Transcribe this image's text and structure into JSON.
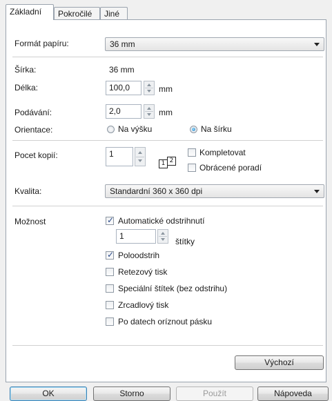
{
  "tabs": [
    {
      "label": "Základní"
    },
    {
      "label": "Pokročilé"
    },
    {
      "label": "Jiné"
    }
  ],
  "paper_format": {
    "label": "Formát papíru:",
    "value": "36 mm"
  },
  "width": {
    "label": "Šírka:",
    "value": "36 mm"
  },
  "length": {
    "label": "Délka:",
    "value": "100,0",
    "unit": "mm"
  },
  "feed": {
    "label": "Podávání:",
    "value": "2,0",
    "unit": "mm"
  },
  "orientation": {
    "label": "Orientace:",
    "portrait": "Na výšku",
    "landscape": "Na šírku",
    "selected": "landscape"
  },
  "copies": {
    "label": "Pocet kopií:",
    "value": "1",
    "collate": "Kompletovat",
    "reverse": "Obrácené poradí",
    "icon_pages": [
      "1",
      "2"
    ]
  },
  "quality": {
    "label": "Kvalita:",
    "value": "Standardní 360 x 360 dpi"
  },
  "options": {
    "label": "Možnost",
    "auto_cut": "Automatické odstrihnutí",
    "every_value": "1",
    "every_unit": "štítky",
    "half_cut": "Poloodstrih",
    "chain_print": "Retezový tisk",
    "special_tape": "Speciální štítek (bez odstrihu)",
    "mirror": "Zrcadlový tisk",
    "cut_tape_after": "Po datech oríznout pásku"
  },
  "default_button": "Výchozí",
  "footer": {
    "ok": "OK",
    "cancel": "Storno",
    "apply": "Použít",
    "help": "Nápoveda"
  }
}
